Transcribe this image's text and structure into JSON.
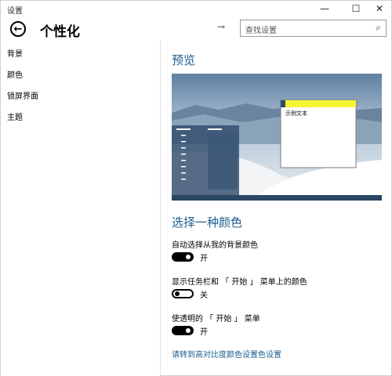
{
  "window": {
    "title": "设置",
    "minimize": "—",
    "maximize": "☐",
    "close": "✕"
  },
  "header": {
    "title": "个性化",
    "search_placeholder": "查找设置"
  },
  "sidebar": {
    "items": [
      {
        "label": "背景"
      },
      {
        "label": "颜色"
      },
      {
        "label": "锁屏界面"
      },
      {
        "label": "主题"
      }
    ]
  },
  "main": {
    "preview_heading": "预览",
    "preview": {
      "sample_text": "示例文本",
      "accent_color": "#f5f532"
    },
    "color_heading": "选择一种颜色",
    "settings": [
      {
        "label": "自动选择从我的背景颜色",
        "state": "开",
        "on": true
      },
      {
        "label": "显示任务栏和 「 开始 」 菜单上的颜色",
        "state": "关",
        "on": false
      },
      {
        "label": "使透明的 「 开始 」 菜单",
        "state": "开",
        "on": true
      }
    ],
    "link": "请转到高对比度颜色设置色设置"
  }
}
